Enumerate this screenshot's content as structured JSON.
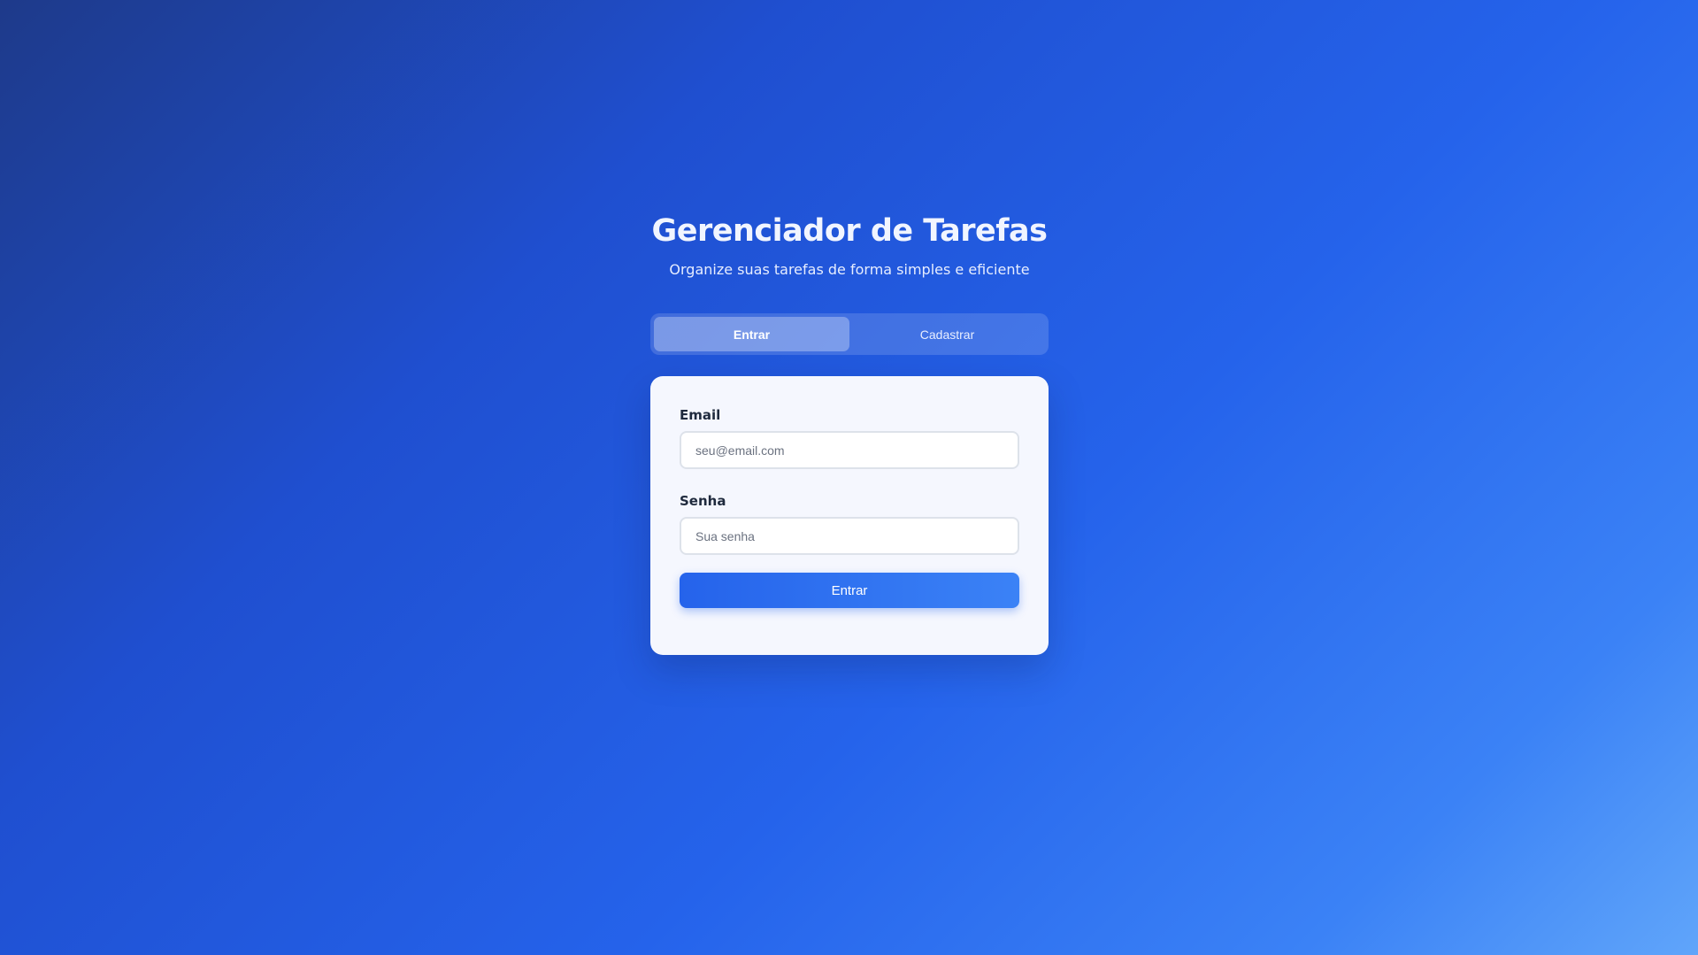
{
  "header": {
    "title": "Gerenciador de Tarefas",
    "subtitle": "Organize suas tarefas de forma simples e eficiente"
  },
  "tabs": [
    {
      "label": "Entrar",
      "active": true
    },
    {
      "label": "Cadastrar",
      "active": false
    }
  ],
  "form": {
    "email": {
      "label": "Email",
      "placeholder": "seu@email.com",
      "value": ""
    },
    "password": {
      "label": "Senha",
      "placeholder": "Sua senha",
      "value": ""
    },
    "submit_label": "Entrar"
  },
  "colors": {
    "accent": "#2563eb",
    "background_start": "#1e3a8a",
    "background_end": "#60a5fa",
    "card": "#f5f7fe"
  }
}
